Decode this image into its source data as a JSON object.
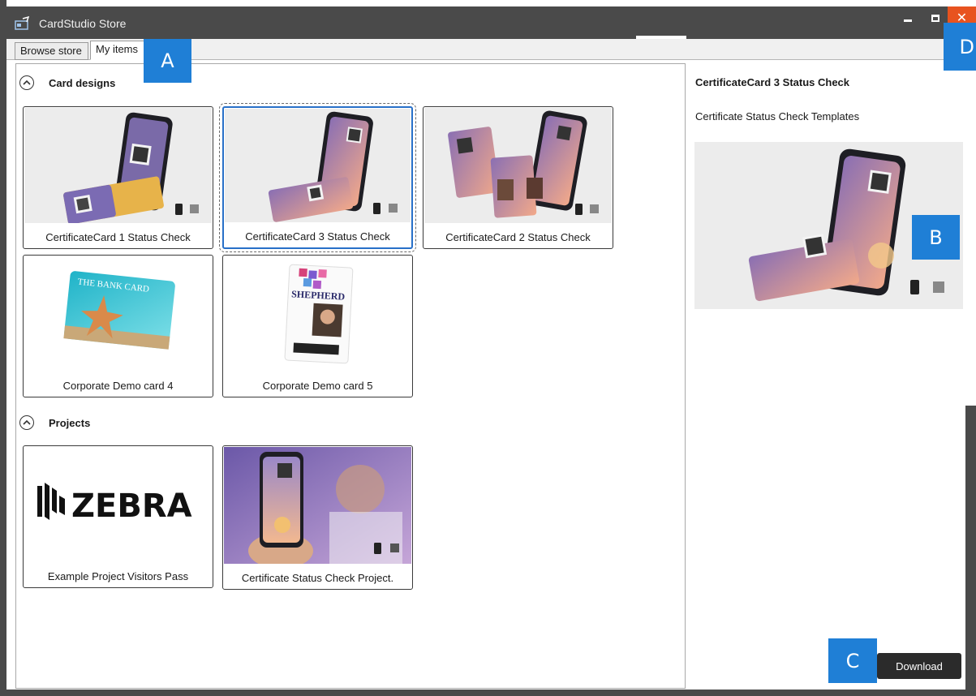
{
  "window": {
    "title": "CardStudio Store",
    "close_glyph": "✕"
  },
  "tabs": [
    {
      "label": "Browse store"
    },
    {
      "label": "My items"
    }
  ],
  "callouts": {
    "a": "A",
    "b": "B",
    "c": "C",
    "d": "D"
  },
  "sections": {
    "card_designs": {
      "title": "Card designs",
      "items": [
        {
          "label": "CertificateCard 1 Status Check"
        },
        {
          "label": "CertificateCard 3 Status Check"
        },
        {
          "label": "CertificateCard 2 Status Check"
        },
        {
          "label": "Corporate Demo card 4"
        },
        {
          "label": "Corporate Demo card 5"
        }
      ]
    },
    "projects": {
      "title": "Projects",
      "items": [
        {
          "label": "Example Project Visitors Pass"
        },
        {
          "label": "Certificate Status Check Project."
        }
      ]
    }
  },
  "thumb_text": {
    "bank_card": "THE BANK CARD",
    "shepherd": "SHEPHERD",
    "zebra_logo": "ZEBRA"
  },
  "detail": {
    "title": "CertificateCard 3 Status Check",
    "description": "Certificate Status Check Templates",
    "download_label": "Download"
  },
  "colors": {
    "titlebar": "#4a4a4a",
    "close_button": "#e8531f",
    "callout": "#1f7fd6",
    "selection": "#2870c8",
    "download_button": "#2b2b2b"
  },
  "icons": [
    "app-icon",
    "minimize-icon",
    "maximize-icon",
    "close-icon",
    "collapse-up-icon",
    "phone-icon",
    "qr-code-icon"
  ]
}
